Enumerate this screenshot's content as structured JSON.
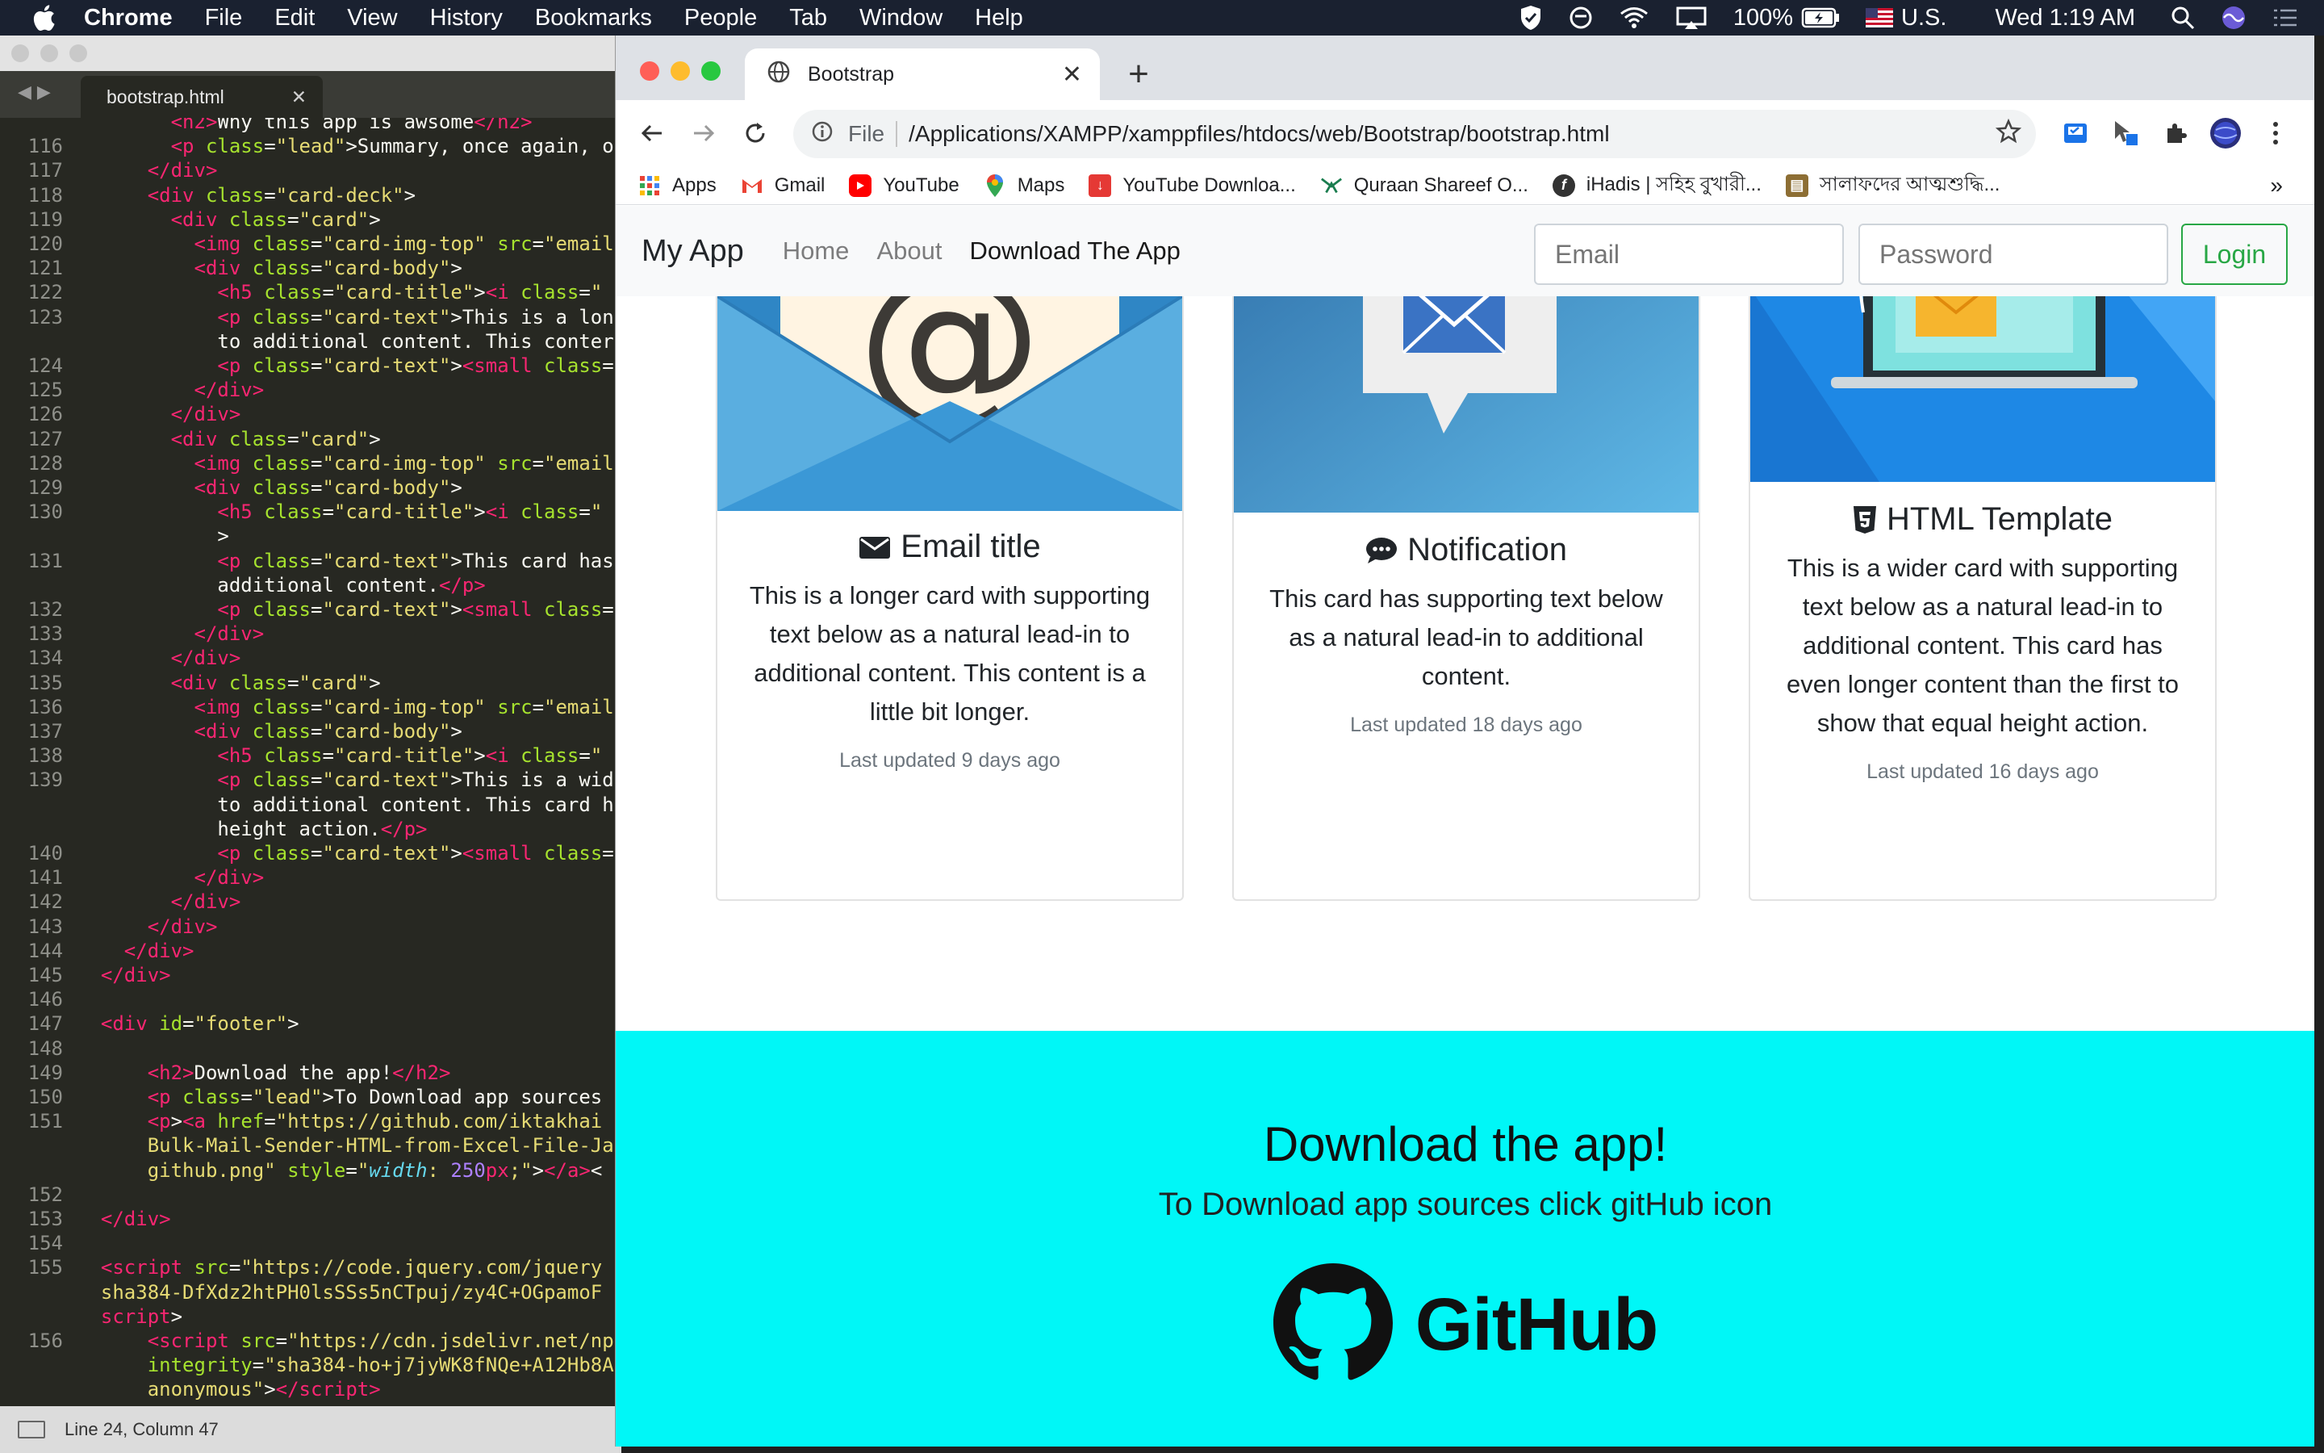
{
  "menubar": {
    "app_name": "Chrome",
    "items": [
      "File",
      "Edit",
      "View",
      "History",
      "Bookmarks",
      "People",
      "Tab",
      "Window",
      "Help"
    ],
    "battery": "100%",
    "input_source": "U.S.",
    "clock": "Wed 1:19 AM"
  },
  "editor": {
    "tab_label": "bootstrap.html",
    "status": "Line 24, Column 47",
    "lines": [
      {
        "n": "",
        "html": "        <span class='t'>&lt;h2&gt;</span>Why this app is awsome<span class='t'>&lt;/h2&gt;</span>"
      },
      {
        "n": "116",
        "html": "        <span class='t'>&lt;p</span> <span class='a'>class</span>=<span class='s'>\"lead\"</span>&gt;Summary, once again, o"
      },
      {
        "n": "117",
        "html": "      <span class='t'>&lt;/div&gt;</span>"
      },
      {
        "n": "118",
        "html": "      <span class='t'>&lt;div</span> <span class='a'>class</span>=<span class='s'>\"card-deck\"</span>&gt;"
      },
      {
        "n": "119",
        "html": "        <span class='t'>&lt;div</span> <span class='a'>class</span>=<span class='s'>\"card\"</span>&gt;"
      },
      {
        "n": "120",
        "html": "          <span class='t'>&lt;img</span> <span class='a'>class</span>=<span class='s'>\"card-img-top\"</span> <span class='a'>src</span>=<span class='s'>\"email</span>"
      },
      {
        "n": "121",
        "html": "          <span class='t'>&lt;div</span> <span class='a'>class</span>=<span class='s'>\"card-body\"</span>&gt;"
      },
      {
        "n": "122",
        "html": "            <span class='t'>&lt;h5</span> <span class='a'>class</span>=<span class='s'>\"card-title\"</span>&gt;<span class='t'>&lt;i</span> <span class='a'>class</span>=<span class='s'>\"</span>"
      },
      {
        "n": "123",
        "html": "            <span class='t'>&lt;p</span> <span class='a'>class</span>=<span class='s'>\"card-text\"</span>&gt;This is a lon"
      },
      {
        "n": "",
        "html": "            to additional content. This conter"
      },
      {
        "n": "124",
        "html": "            <span class='t'>&lt;p</span> <span class='a'>class</span>=<span class='s'>\"card-text\"</span>&gt;<span class='t'>&lt;small</span> <span class='a'>class</span>="
      },
      {
        "n": "125",
        "html": "          <span class='t'>&lt;/div&gt;</span>"
      },
      {
        "n": "126",
        "html": "        <span class='t'>&lt;/div&gt;</span>"
      },
      {
        "n": "127",
        "html": "        <span class='t'>&lt;div</span> <span class='a'>class</span>=<span class='s'>\"card\"</span>&gt;"
      },
      {
        "n": "128",
        "html": "          <span class='t'>&lt;img</span> <span class='a'>class</span>=<span class='s'>\"card-img-top\"</span> <span class='a'>src</span>=<span class='s'>\"email</span>"
      },
      {
        "n": "129",
        "html": "          <span class='t'>&lt;div</span> <span class='a'>class</span>=<span class='s'>\"card-body\"</span>&gt;"
      },
      {
        "n": "130",
        "html": "            <span class='t'>&lt;h5</span> <span class='a'>class</span>=<span class='s'>\"card-title\"</span>&gt;<span class='t'>&lt;i</span> <span class='a'>class</span>=<span class='s'>\"</span>"
      },
      {
        "n": "",
        "html": "            &gt;"
      },
      {
        "n": "131",
        "html": "            <span class='t'>&lt;p</span> <span class='a'>class</span>=<span class='s'>\"card-text\"</span>&gt;This card has"
      },
      {
        "n": "",
        "html": "            additional content.<span class='t'>&lt;/p&gt;</span>"
      },
      {
        "n": "132",
        "html": "            <span class='t'>&lt;p</span> <span class='a'>class</span>=<span class='s'>\"card-text\"</span>&gt;<span class='t'>&lt;small</span> <span class='a'>class</span>="
      },
      {
        "n": "133",
        "html": "          <span class='t'>&lt;/div&gt;</span>"
      },
      {
        "n": "134",
        "html": "        <span class='t'>&lt;/div&gt;</span>"
      },
      {
        "n": "135",
        "html": "        <span class='t'>&lt;div</span> <span class='a'>class</span>=<span class='s'>\"card\"</span>&gt;"
      },
      {
        "n": "136",
        "html": "          <span class='t'>&lt;img</span> <span class='a'>class</span>=<span class='s'>\"card-img-top\"</span> <span class='a'>src</span>=<span class='s'>\"email</span>"
      },
      {
        "n": "137",
        "html": "          <span class='t'>&lt;div</span> <span class='a'>class</span>=<span class='s'>\"card-body\"</span>&gt;"
      },
      {
        "n": "138",
        "html": "            <span class='t'>&lt;h5</span> <span class='a'>class</span>=<span class='s'>\"card-title\"</span>&gt;<span class='t'>&lt;i</span> <span class='a'>class</span>=<span class='s'>\"</span>"
      },
      {
        "n": "139",
        "html": "            <span class='t'>&lt;p</span> <span class='a'>class</span>=<span class='s'>\"card-text\"</span>&gt;This is a wid"
      },
      {
        "n": "",
        "html": "            to additional content. This card h"
      },
      {
        "n": "",
        "html": "            height action.<span class='t'>&lt;/p&gt;</span>"
      },
      {
        "n": "140",
        "html": "            <span class='t'>&lt;p</span> <span class='a'>class</span>=<span class='s'>\"card-text\"</span>&gt;<span class='t'>&lt;small</span> <span class='a'>class</span>="
      },
      {
        "n": "141",
        "html": "          <span class='t'>&lt;/div&gt;</span>"
      },
      {
        "n": "142",
        "html": "        <span class='t'>&lt;/div&gt;</span>"
      },
      {
        "n": "143",
        "html": "      <span class='t'>&lt;/div&gt;</span>"
      },
      {
        "n": "144",
        "html": "    <span class='t'>&lt;/div&gt;</span>"
      },
      {
        "n": "145",
        "html": "  <span class='t'>&lt;/div&gt;</span>"
      },
      {
        "n": "146",
        "html": ""
      },
      {
        "n": "147",
        "html": "  <span class='t'>&lt;div</span> <span class='a'>id</span>=<span class='s'>\"footer\"</span>&gt;"
      },
      {
        "n": "148",
        "html": ""
      },
      {
        "n": "149",
        "html": "      <span class='t'>&lt;h2&gt;</span>Download the app!<span class='t'>&lt;/h2&gt;</span>"
      },
      {
        "n": "150",
        "html": "      <span class='t'>&lt;p</span> <span class='a'>class</span>=<span class='s'>\"lead\"</span>&gt;To Download app sources"
      },
      {
        "n": "151",
        "html": "      <span class='t'>&lt;p</span>&gt;<span class='t'>&lt;a</span> <span class='a'>href</span>=<span class='s'>\"https://github.com/iktakhai</span>"
      },
      {
        "n": "",
        "html": "      <span class='s'>Bulk-Mail-Sender-HTML-from-Excel-File-Ja</span>"
      },
      {
        "n": "",
        "html": "      <span class='s'>github.png\"</span> <span class='a'>style</span>=<span class='s'>\"</span><span class='i'>width</span><span class='s'>: </span><span class='n'>250</span><span class='t'>px</span><span class='s'>;\"</span>&gt;<span class='t'>&lt;/a&gt;</span>&lt;"
      },
      {
        "n": "152",
        "html": ""
      },
      {
        "n": "153",
        "html": "  <span class='t'>&lt;/div&gt;</span>"
      },
      {
        "n": "154",
        "html": ""
      },
      {
        "n": "155",
        "html": "  <span class='t'>&lt;script</span> <span class='a'>src</span>=<span class='s'>\"https://code.jquery.com/jquery</span>"
      },
      {
        "n": "",
        "html": "  <span class='s'>sha384-DfXdz2htPH0lsSSs5nCTpuj/zy4C+OGpamoF</span>"
      },
      {
        "n": "",
        "html": "  <span class='t'>script</span>&gt;"
      },
      {
        "n": "156",
        "html": "      <span class='t'>&lt;script</span> <span class='a'>src</span>=<span class='s'>\"https://cdn.jsdelivr.net/np</span>"
      },
      {
        "n": "",
        "html": "      <span class='a'>integrity</span>=<span class='s'>\"sha384-ho+j7jyWK8fNQe+A12Hb8A</span>"
      },
      {
        "n": "",
        "html": "      <span class='s'>anonymous\"</span>&gt;<span class='t'>&lt;/script&gt;</span>"
      },
      {
        "n": "157",
        "html": ""
      }
    ]
  },
  "chrome": {
    "tab_title": "Bootstrap",
    "url_scheme": "File",
    "url_path": "/Applications/XAMPP/xamppfiles/htdocs/web/Bootstrap/bootstrap.html",
    "bookmarks": [
      {
        "label": "Apps",
        "icon": "apps-grid-icon"
      },
      {
        "label": "Gmail",
        "icon": "gmail-icon"
      },
      {
        "label": "YouTube",
        "icon": "youtube-icon"
      },
      {
        "label": "Maps",
        "icon": "maps-pin-icon"
      },
      {
        "label": "YouTube Downloa...",
        "icon": "download-icon"
      },
      {
        "label": "Quraan Shareef O...",
        "icon": "quran-icon"
      },
      {
        "label": "iHadis | সহিহ বুখারী...",
        "icon": "ihadis-icon"
      },
      {
        "label": "সালাফদের আত্মশুদ্ধি...",
        "icon": "book-icon"
      }
    ],
    "bookmarks_overflow": "»"
  },
  "page": {
    "brand": "My App",
    "nav": [
      "Home",
      "About",
      "Download The App"
    ],
    "email_placeholder": "Email",
    "password_placeholder": "Password",
    "login_label": "Login",
    "cards": [
      {
        "title": "Email title",
        "text": "This is a longer card with supporting text below as a natural lead-in to additional content. This content is a little bit longer.",
        "updated": "Last updated 9 days ago"
      },
      {
        "title": "Notification",
        "text": "This card has supporting text below as a natural lead-in to additional content.",
        "updated": "Last updated 18 days ago"
      },
      {
        "title": "HTML Template",
        "text": "This is a wider card with supporting text below as a natural lead-in to additional content. This card has even longer content than the first to show that equal height action.",
        "updated": "Last updated 16 days ago"
      }
    ],
    "footer": {
      "heading": "Download the app!",
      "lead": "To Download app sources click gitHub icon",
      "github_word": "GitHub"
    }
  },
  "colors": {
    "footer_bg": "#00f7f7",
    "login_green": "#28a745",
    "editor_bg": "#272822"
  }
}
